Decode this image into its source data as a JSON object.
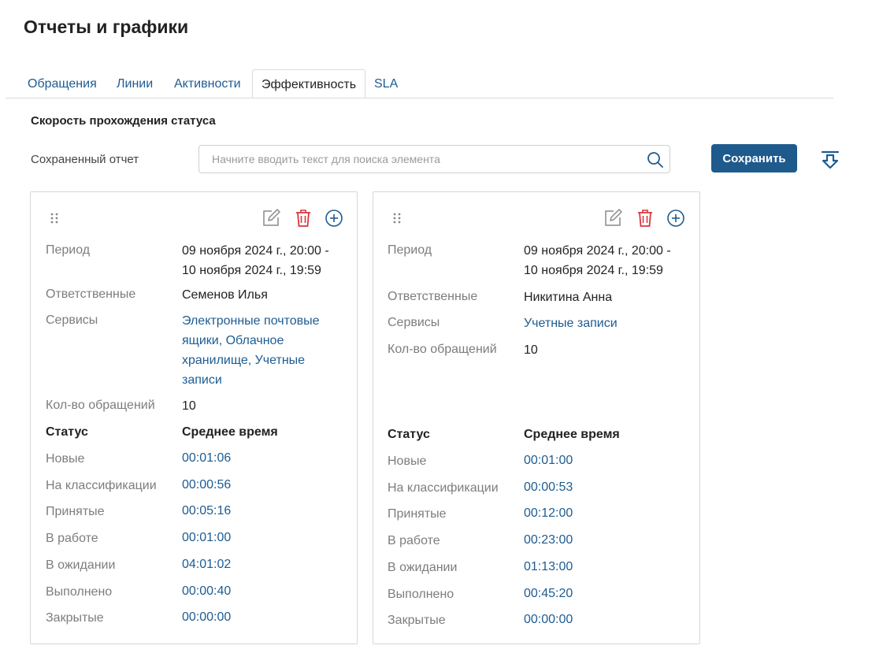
{
  "page": {
    "title": "Отчеты и графики"
  },
  "tabs": [
    {
      "label": "Обращения",
      "active": false
    },
    {
      "label": "Линии",
      "active": false
    },
    {
      "label": "Активности",
      "active": false
    },
    {
      "label": "Эффективность",
      "active": true
    },
    {
      "label": "SLA",
      "active": false
    }
  ],
  "section": {
    "title": "Скорость прохождения статуса"
  },
  "saved_report": {
    "label": "Сохраненный отчет",
    "search_placeholder": "Начните вводить текст для поиска элемента",
    "search_value": ""
  },
  "toolbar": {
    "save_label": "Сохранить"
  },
  "icons": {
    "drag": "drag-handle-icon",
    "edit": "edit-icon",
    "delete": "trash-icon",
    "add": "add-circle-icon",
    "search": "search-icon",
    "download": "download-icon"
  },
  "colors": {
    "accent": "#1f5a8c",
    "link": "#1d5c92",
    "delete": "#d9363e"
  },
  "labels": {
    "period": "Период",
    "responsible": "Ответственные",
    "services": "Сервисы",
    "count": "Кол-во обращений",
    "status_header": "Статус",
    "avg_time_header": "Среднее время"
  },
  "cards": [
    {
      "period_line1": "09 ноября 2024 г., 20:00 -",
      "period_line2": "10 ноября 2024 г., 19:59",
      "responsible": "Семенов Илья",
      "services": [
        "Электронные почтовые",
        "ящики, Облачное",
        "хранилище, Учетные",
        "записи"
      ],
      "count": "10",
      "statuses": [
        {
          "status": "Новые",
          "time": "00:01:06"
        },
        {
          "status": "На классификации",
          "time": "00:00:56"
        },
        {
          "status": "Принятые",
          "time": "00:05:16"
        },
        {
          "status": "В работе",
          "time": "00:01:00"
        },
        {
          "status": "В ожидании",
          "time": "04:01:02"
        },
        {
          "status": "Выполнено",
          "time": "00:00:40"
        },
        {
          "status": "Закрытые",
          "time": "00:00:00"
        }
      ]
    },
    {
      "period_line1": "09 ноября 2024 г., 20:00 -",
      "period_line2": "10 ноября 2024 г., 19:59",
      "responsible": "Никитина Анна",
      "services": [
        "Учетные записи"
      ],
      "count": "10",
      "statuses": [
        {
          "status": "Новые",
          "time": "00:01:00"
        },
        {
          "status": "На классификации",
          "time": "00:00:53"
        },
        {
          "status": "Принятые",
          "time": "00:12:00"
        },
        {
          "status": "В работе",
          "time": "00:23:00"
        },
        {
          "status": "В ожидании",
          "time": "01:13:00"
        },
        {
          "status": "Выполнено",
          "time": "00:45:20"
        },
        {
          "status": "Закрытые",
          "time": "00:00:00"
        }
      ]
    }
  ]
}
